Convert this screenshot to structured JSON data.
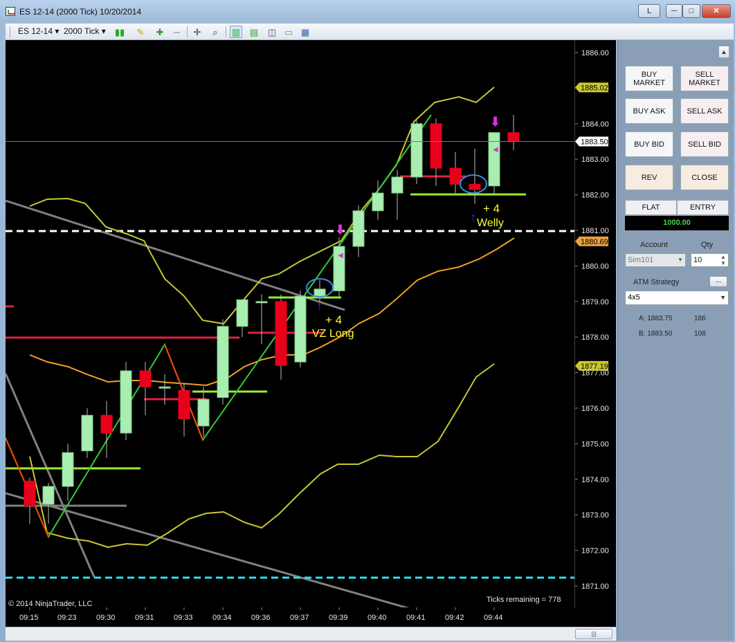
{
  "window": {
    "title": "ES 12-14 (2000 Tick)  10/20/2014",
    "buttons": {
      "link": "L",
      "minimize": "─",
      "maximize": "□",
      "close": "✕"
    }
  },
  "toolbar": {
    "instrument": "ES 12-14",
    "interval": "2000 Tick",
    "dropdown_glyph": "▾"
  },
  "chart": {
    "copyright": "© 2014 NinjaTrader, LLC",
    "ticks_remaining": "Ticks remaining = 778",
    "annotations": [
      {
        "text": "+ 4",
        "color": "#ffff33"
      },
      {
        "text": "VZ Long",
        "color": "#ffff33"
      },
      {
        "text": "+ 4",
        "color": "#ffff33"
      },
      {
        "text": "Welly",
        "color": "#ffff33"
      }
    ],
    "price_ticks": [
      "1886.00",
      "1885.00",
      "1884.00",
      "1883.00",
      "1882.00",
      "1881.00",
      "1880.00",
      "1879.00",
      "1878.00",
      "1877.00",
      "1876.00",
      "1875.00",
      "1874.00",
      "1873.00",
      "1872.00",
      "1871.00"
    ],
    "price_markers": [
      {
        "label": "1885.02",
        "price": 1885.02,
        "bg": "#c8c832"
      },
      {
        "label": "1883.50",
        "price": 1883.5,
        "bg": "#ffffff"
      },
      {
        "label": "1880.69",
        "price": 1880.69,
        "bg": "#e8a040"
      },
      {
        "label": "1877.19",
        "price": 1877.19,
        "bg": "#c8c832"
      }
    ],
    "time_ticks": [
      "09:15",
      "09:23",
      "09:30",
      "09:31",
      "09:33",
      "09:34",
      "09:36",
      "09:37",
      "09:39",
      "09:40",
      "09:41",
      "09:42",
      "09:44"
    ],
    "colors": {
      "up": "#a8eeb0",
      "down": "#e8001a",
      "upper_band": "#c8c832",
      "mid_band": "#f0a020",
      "trend": "#808080",
      "zigzag_up": "#33cc33",
      "zigzag_down": "#ff4400",
      "level_white": "#ffffff",
      "level_cyan": "#33e0f0",
      "stop": "#e02040",
      "target": "#99ee33"
    }
  },
  "panel": {
    "buy_market": "BUY\nMARKET",
    "sell_market": "SELL\nMARKET",
    "buy_ask": "BUY ASK",
    "sell_ask": "SELL ASK",
    "buy_bid": "BUY BID",
    "sell_bid": "SELL BID",
    "rev": "REV",
    "close": "CLOSE",
    "flat": "FLAT",
    "entry": "ENTRY",
    "pnl": "1000.00",
    "account_label": "Account",
    "qty_label": "Qty",
    "account_value": "Sim101",
    "qty_value": "10",
    "atm_label": "ATM Strategy",
    "atm_btn": "...",
    "atm_value": "4x5",
    "ask_label": "A: 1883.75",
    "ask_size": "186",
    "bid_label": "B: 1883.50",
    "bid_size": "108"
  },
  "scroll": {
    "thumb": "|||"
  }
}
